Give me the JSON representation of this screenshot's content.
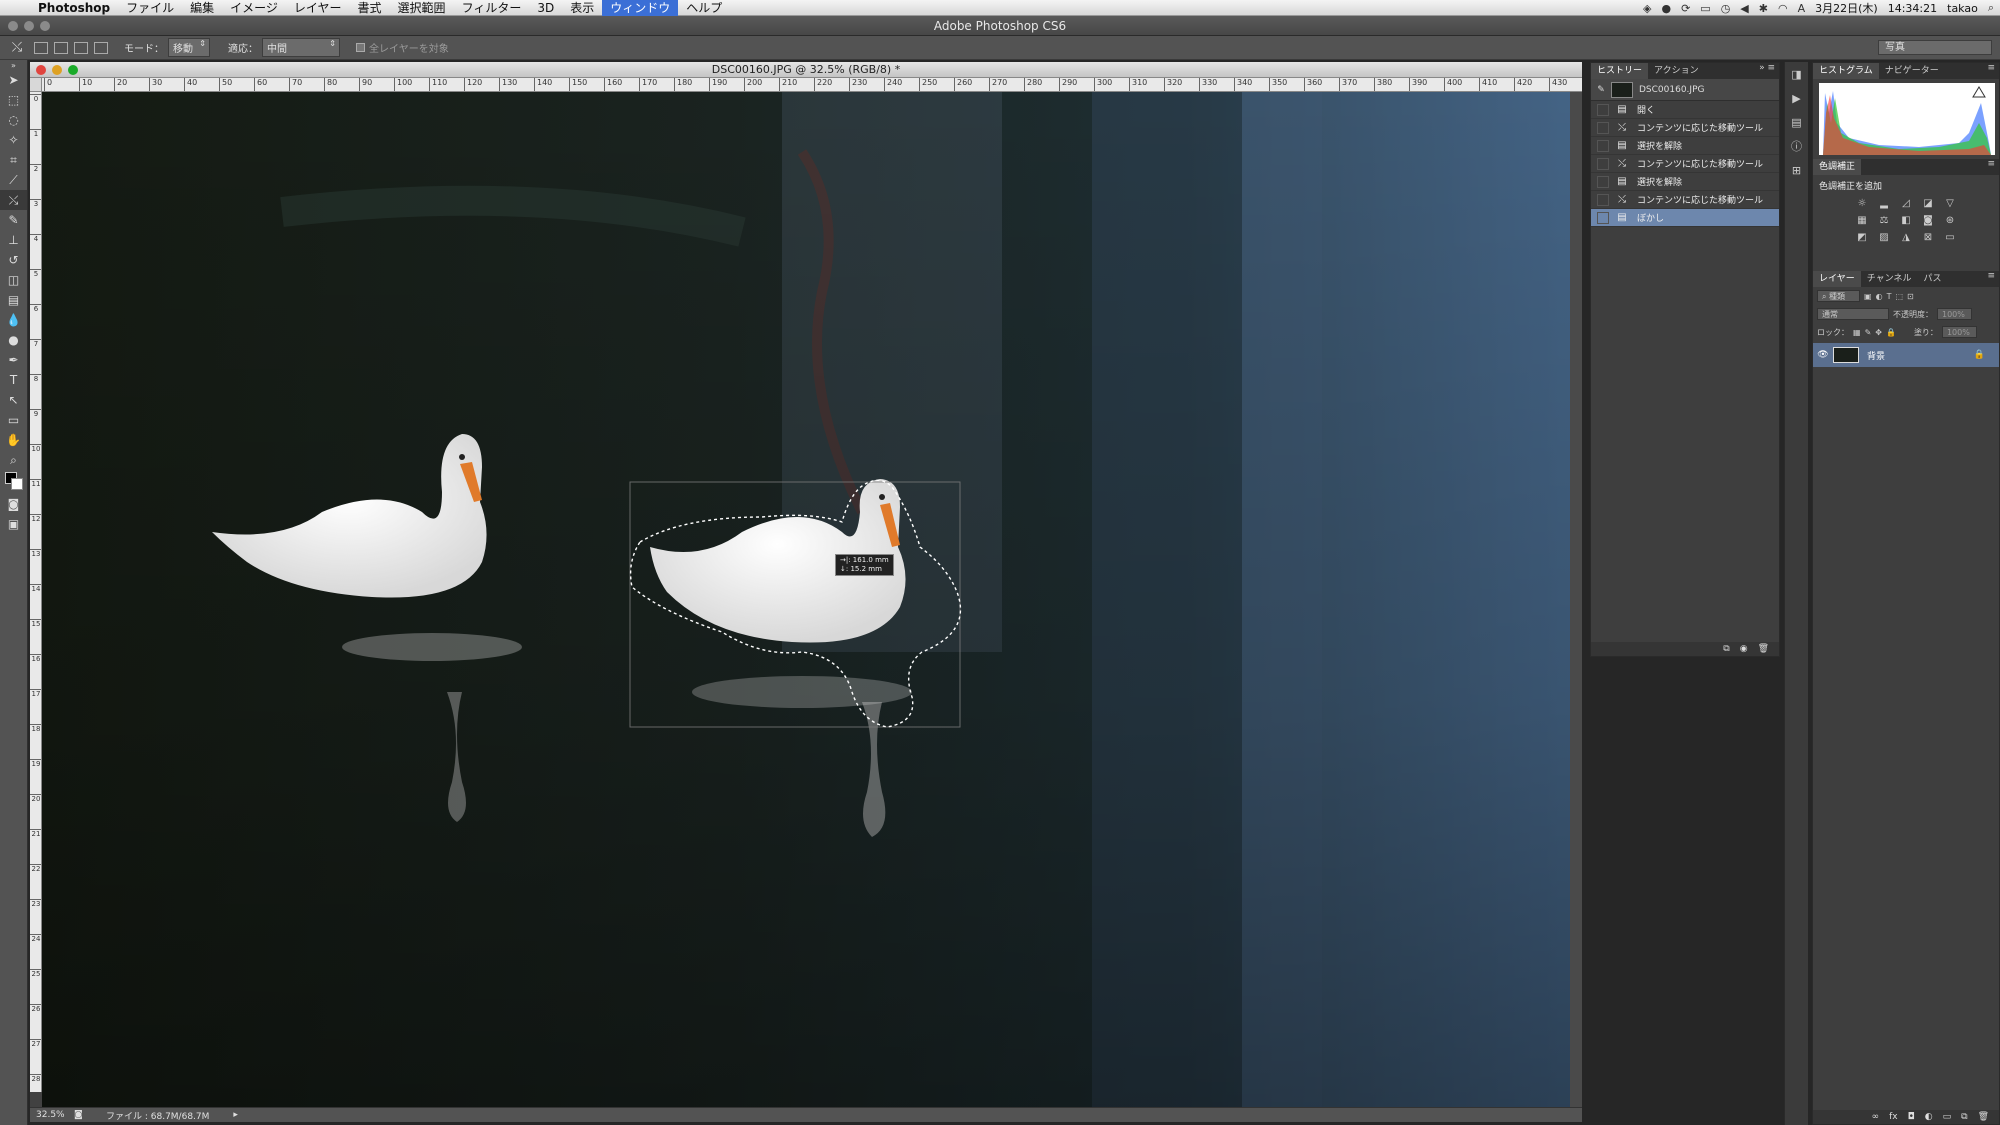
{
  "menubar": {
    "app": "Photoshop",
    "items": [
      "ファイル",
      "編集",
      "イメージ",
      "レイヤー",
      "書式",
      "選択範囲",
      "フィルター",
      "3D",
      "表示",
      "ウィンドウ",
      "ヘルプ"
    ],
    "active": "ウィンドウ",
    "date": "3月22日(木)",
    "time": "14:34:21",
    "user": "takao"
  },
  "window_title": "Adobe Photoshop CS6",
  "options": {
    "mode_label": "モード：",
    "mode_value": "移動",
    "adapt_label": "適応：",
    "adapt_value": "中間",
    "all_layers": "全レイヤーを対象",
    "workspace": "写真"
  },
  "document": {
    "title": "DSC00160.JPG @ 32.5% (RGB/8) *",
    "ruler_h": [
      "0",
      "10",
      "20",
      "30",
      "40",
      "50",
      "60",
      "70",
      "80",
      "90",
      "100",
      "110",
      "120",
      "130",
      "140",
      "150",
      "160",
      "170",
      "180",
      "190",
      "200",
      "210",
      "220",
      "230",
      "240",
      "250",
      "260",
      "270",
      "280",
      "290",
      "300",
      "310",
      "320",
      "330",
      "340",
      "350",
      "360",
      "370",
      "380",
      "390",
      "400",
      "410",
      "420",
      "430"
    ],
    "ruler_v": [
      "0",
      "1",
      "2",
      "3",
      "4",
      "5",
      "6",
      "7",
      "8",
      "9",
      "10",
      "11",
      "12",
      "13",
      "14",
      "15",
      "16",
      "17",
      "18",
      "19",
      "20",
      "21",
      "22",
      "23",
      "24",
      "25",
      "26",
      "27",
      "28",
      "29",
      "30"
    ],
    "tooltip_x": "→|: 161.0 mm",
    "tooltip_y": "↓: 15.2 mm",
    "zoom": "32.5%",
    "file_info": "ファイル : 68.7M/68.7M"
  },
  "history": {
    "tabs": [
      "ヒストリー",
      "アクション"
    ],
    "snapshot": "DSC00160.JPG",
    "items": [
      {
        "icon": "open-icon",
        "label": "開く"
      },
      {
        "icon": "content-move-icon",
        "label": "コンテンツに応じた移動ツール"
      },
      {
        "icon": "deselect-icon",
        "label": "選択を解除"
      },
      {
        "icon": "content-move-icon",
        "label": "コンテンツに応じた移動ツール"
      },
      {
        "icon": "deselect-icon",
        "label": "選択を解除"
      },
      {
        "icon": "content-move-icon",
        "label": "コンテンツに応じた移動ツール"
      },
      {
        "icon": "blur-icon",
        "label": "ぼかし"
      }
    ],
    "selected_index": 6
  },
  "histogram": {
    "tabs": [
      "ヒストグラム",
      "ナビゲーター"
    ]
  },
  "adjustments": {
    "tab": "色調補正",
    "label": "色調補正を追加"
  },
  "layers": {
    "tabs": [
      "レイヤー",
      "チャンネル",
      "パス"
    ],
    "kind": "種類",
    "blend": "通常",
    "opacity_label": "不透明度：",
    "opacity": "100%",
    "lock_label": "ロック：",
    "fill_label": "塗り：",
    "fill": "100%",
    "layer_name": "背景"
  },
  "colors": {
    "selection_blue": "#6d87ad",
    "water": "#151b16",
    "swan": "#f2f2f2",
    "beak": "#e07a2a"
  }
}
